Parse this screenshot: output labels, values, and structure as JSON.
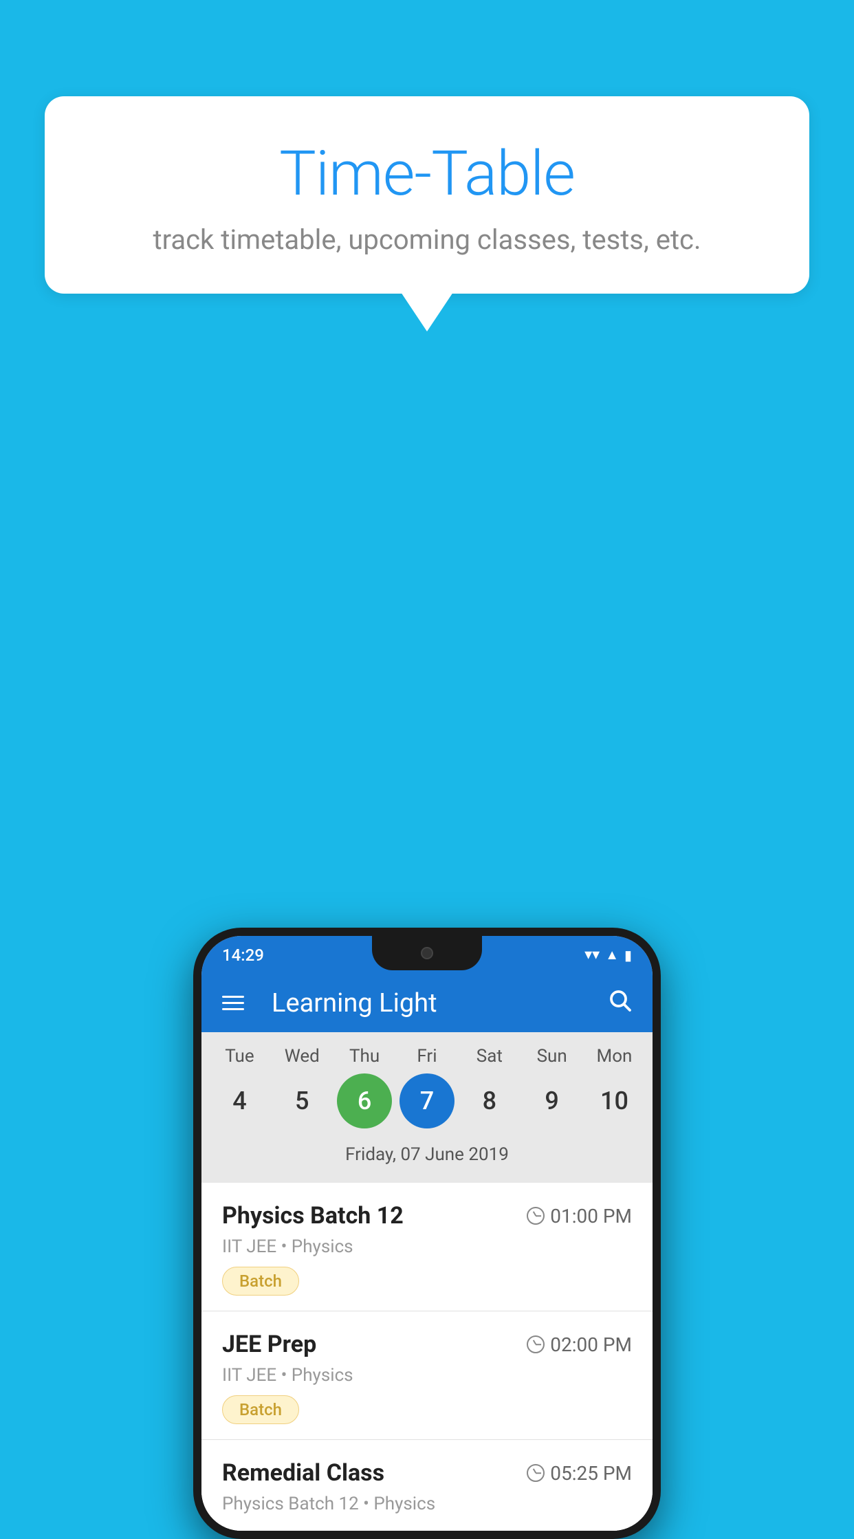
{
  "background_color": "#1ab8e8",
  "bubble": {
    "title": "Time-Table",
    "subtitle": "track timetable, upcoming classes, tests, etc."
  },
  "phone": {
    "status_bar": {
      "time": "14:29",
      "icons": [
        "wifi",
        "signal",
        "battery"
      ]
    },
    "app_bar": {
      "title": "Learning Light"
    },
    "calendar": {
      "days": [
        {
          "name": "Tue",
          "number": "4",
          "state": "normal"
        },
        {
          "name": "Wed",
          "number": "5",
          "state": "normal"
        },
        {
          "name": "Thu",
          "number": "6",
          "state": "today"
        },
        {
          "name": "Fri",
          "number": "7",
          "state": "selected"
        },
        {
          "name": "Sat",
          "number": "8",
          "state": "normal"
        },
        {
          "name": "Sun",
          "number": "9",
          "state": "normal"
        },
        {
          "name": "Mon",
          "number": "10",
          "state": "normal"
        }
      ],
      "selected_date_label": "Friday, 07 June 2019"
    },
    "schedule": [
      {
        "title": "Physics Batch 12",
        "time": "01:00 PM",
        "meta": "IIT JEE • Physics",
        "tag": "Batch"
      },
      {
        "title": "JEE Prep",
        "time": "02:00 PM",
        "meta": "IIT JEE • Physics",
        "tag": "Batch"
      },
      {
        "title": "Remedial Class",
        "time": "05:25 PM",
        "meta": "Physics Batch 12 • Physics",
        "tag": null
      }
    ]
  }
}
